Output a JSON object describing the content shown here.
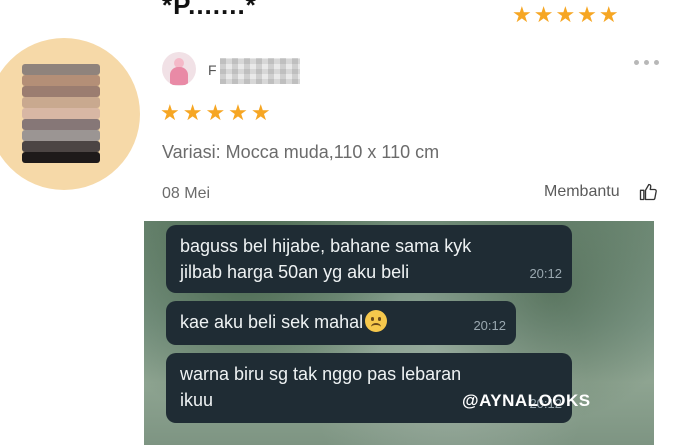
{
  "top": {
    "title": "*P.......*",
    "stars": "★★★★★"
  },
  "review": {
    "username_initial": "F",
    "stars": "★★★★★",
    "variation": "Variasi: Mocca muda,110 x 110 cm",
    "date": "08 Mei",
    "helpful_label": "Membantu"
  },
  "image": {
    "messages": [
      {
        "text": "baguss bel hijabe, bahane sama kyk\njilbab harga 50an yg aku beli",
        "time": "20:12"
      },
      {
        "text": "kae aku beli sek mahal",
        "time": "20:12"
      },
      {
        "text": "warna biru sg tak nggo pas lebaran\nikuu",
        "time": "20:12"
      }
    ],
    "watermark": "@AYNALOOKS"
  },
  "colors": {
    "star": "#f6a623",
    "bubble": "#1f2c34",
    "text_muted": "#6b6b6b"
  },
  "icons": [
    "more-icon",
    "thumbs-up-icon",
    "sad-face-icon"
  ]
}
